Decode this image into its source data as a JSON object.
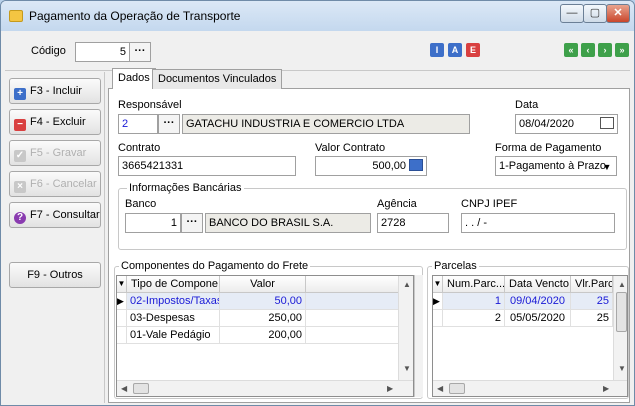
{
  "window": {
    "title": "Pagamento da Operação de Transporte",
    "minimize_label": "—",
    "maximize_label": "▢",
    "close_label": "✕"
  },
  "header": {
    "codigo_label": "Código",
    "codigo_value": "5",
    "lookup_label": "···",
    "info_btn": "I",
    "alter_btn": "A",
    "exclude_btn": "E",
    "nav_first": "«",
    "nav_prev": "‹",
    "nav_next": "›",
    "nav_last": "»"
  },
  "sidebar": {
    "items": [
      {
        "label": "F3 - Incluir",
        "icon": "plus-icon",
        "enabled": true
      },
      {
        "label": "F4 - Excluir",
        "icon": "minus-icon",
        "enabled": true
      },
      {
        "label": "F5 - Gravar",
        "icon": "check-icon",
        "enabled": false
      },
      {
        "label": "F6 - Cancelar",
        "icon": "x-icon",
        "enabled": false
      },
      {
        "label": "F7 - Consultar",
        "icon": "question-icon",
        "enabled": true
      },
      {
        "label": "F9 - Outros",
        "icon": "",
        "enabled": true
      }
    ]
  },
  "tabs": [
    {
      "label": "Dados",
      "active": true
    },
    {
      "label": "Documentos Vinculados",
      "active": false
    }
  ],
  "form": {
    "responsavel_label": "Responsável",
    "responsavel_code": "2",
    "responsavel_name": "GATACHU INDUSTRIA E COMERCIO LTDA",
    "data_label": "Data",
    "data_value": "08/04/2020",
    "contrato_label": "Contrato",
    "contrato_value": "3665421331",
    "valor_contrato_label": "Valor Contrato",
    "valor_contrato_value": "500,00",
    "forma_pagamento_label": "Forma de Pagamento",
    "forma_pagamento_value": "1-Pagamento à Prazo",
    "bank_group_label": "Informações Bancárias",
    "banco_label": "Banco",
    "banco_code": "1",
    "banco_name": "BANCO DO BRASIL S.A.",
    "agencia_label": "Agência",
    "agencia_value": "2728",
    "cnpj_label": "CNPJ IPEF",
    "cnpj_value": " .  .  /  -"
  },
  "componentes": {
    "title": "Componentes do Pagamento do Frete",
    "headers": [
      "Tipo de Compone...",
      "Valor"
    ],
    "rows": [
      {
        "tipo": "02-Impostos/Taxas",
        "valor": "50,00",
        "selected": true
      },
      {
        "tipo": "03-Despesas",
        "valor": "250,00",
        "selected": false
      },
      {
        "tipo": "01-Vale Pedágio",
        "valor": "200,00",
        "selected": false
      }
    ]
  },
  "parcelas": {
    "title": "Parcelas",
    "headers": [
      "Num.Parc...",
      "Data Vencto",
      "Vlr.Parce"
    ],
    "rows": [
      {
        "num": "1",
        "data": "09/04/2020",
        "valor": "25",
        "selected": true
      },
      {
        "num": "2",
        "data": "05/05/2020",
        "valor": "25",
        "selected": false
      }
    ]
  },
  "colors": {
    "selected_text": "#1a1ad6",
    "selected_row_bg": "#e6ecf6"
  }
}
